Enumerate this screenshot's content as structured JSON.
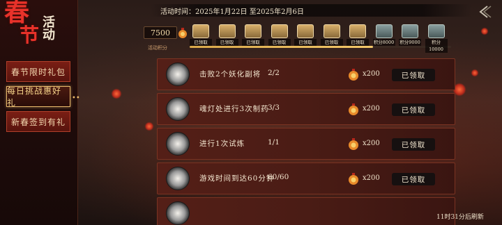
{
  "event": {
    "title_big": "春",
    "title_big2": "节",
    "title_small": "活动",
    "time_text": "活动时间：2025年1月22日 至2025年2月6日",
    "refresh_note": "11时31分后刷新"
  },
  "sidebar": {
    "items": [
      {
        "label": "春节限时礼包",
        "active": false
      },
      {
        "label": "每日挑战惠好礼",
        "active": true
      },
      {
        "label": "新春签到有礼",
        "active": false
      }
    ]
  },
  "progress": {
    "score": "7500",
    "score_label": "活动积分",
    "fill_fraction": 0.7,
    "milestones": [
      {
        "tag": "已领取",
        "claimed": true
      },
      {
        "tag": "已领取",
        "claimed": true
      },
      {
        "tag": "已领取",
        "claimed": true
      },
      {
        "tag": "已领取",
        "claimed": true
      },
      {
        "tag": "已领取",
        "claimed": true
      },
      {
        "tag": "已领取",
        "claimed": true
      },
      {
        "tag": "已领取",
        "claimed": true
      },
      {
        "tag": "积分8000",
        "claimed": false
      },
      {
        "tag": "积分9000",
        "claimed": false
      },
      {
        "tag": "积分10000",
        "claimed": false
      }
    ]
  },
  "tasks": [
    {
      "name": "击败2个妖化副将",
      "progress": "2/2",
      "reward": "x200",
      "status": "已领取",
      "icon": "mask-icon"
    },
    {
      "name": "魂灯处进行3次制药",
      "progress": "3/3",
      "reward": "x200",
      "status": "已领取",
      "icon": "lamp-icon"
    },
    {
      "name": "进行1次试炼",
      "progress": "1/1",
      "reward": "x200",
      "status": "已领取",
      "icon": "monk-icon"
    },
    {
      "name": "游戏时间到达60分钟",
      "progress": "60/60",
      "reward": "x200",
      "status": "已领取",
      "icon": "eye-icon"
    },
    {
      "name": "",
      "progress": "",
      "reward": "",
      "status": "",
      "icon": "gear-icon"
    }
  ]
}
